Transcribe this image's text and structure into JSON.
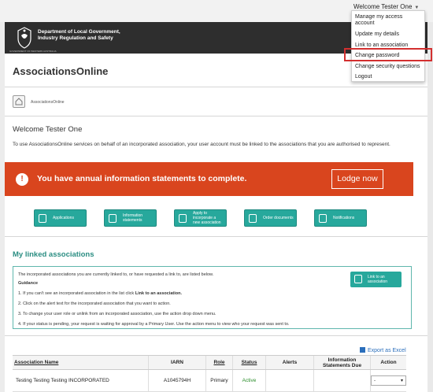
{
  "header": {
    "user_menu_label": "Welcome Tester One",
    "department_line1": "Department of Local Government,",
    "department_line2": "Industry Regulation and Safety",
    "crest_text": "GOVERNMENT OF WESTERN AUSTRALIA"
  },
  "user_menu": {
    "items": [
      {
        "label": "Manage my access account"
      },
      {
        "label": "Update my details"
      },
      {
        "label": "Link to an association"
      },
      {
        "label": "Change password",
        "highlighted": true
      },
      {
        "label": "Change security questions"
      },
      {
        "label": "Logout"
      }
    ],
    "highlight_color": "#d32f2f"
  },
  "app": {
    "title": "AssociationsOnline",
    "breadcrumb": "AssociationsOnline"
  },
  "welcome": {
    "heading": "Welcome Tester One",
    "intro": "To use AssociationsOnline services on behalf of an incorporated association, your user account must be linked to the associations that you are authorised to represent."
  },
  "alert": {
    "icon": "info-icon",
    "message": "You have annual information statements to complete.",
    "button_label": "Lodge now",
    "color": "#d9451e"
  },
  "shortcuts": [
    {
      "label": "Applications",
      "icon": "applications-icon"
    },
    {
      "label": "Information statements",
      "icon": "information-statements-icon"
    },
    {
      "label": "Apply to incorporate a new association",
      "icon": "incorporate-icon"
    },
    {
      "label": "Order documents",
      "icon": "order-documents-icon"
    },
    {
      "label": "Notifications",
      "icon": "notifications-icon"
    }
  ],
  "linked": {
    "title": "My linked associations",
    "intro": "The incorporated associations you are currently linked to, or have requested a link to, are listed below.",
    "guidance_heading": "Guidance",
    "guidance": [
      {
        "text": "1. If you can't see an incorporated association in the list click ",
        "bold": "Link to an association."
      },
      {
        "text": "2. Click on the alert text for the incorporated association that you want to action.",
        "bold": ""
      },
      {
        "text": "3. To change your user role or unlink from an incorporated association, use the action drop down menu.",
        "bold": ""
      },
      {
        "text": "4. If your status is pending, your request is waiting for approval by a Primary User. Use the action menu to view who your request was sent to.",
        "bold": ""
      }
    ],
    "link_button_label": "Link to an association",
    "accent_color": "#27a89c"
  },
  "table": {
    "export_label": "Export as Excel",
    "headers": [
      "Association Name",
      "IARN",
      "Role",
      "Status",
      "Alerts",
      "Information Statements Due",
      "Action"
    ],
    "rows": [
      {
        "name": "Testing Testing Testing INCORPORATED",
        "iarn": "A1045794H",
        "role": "Primary",
        "status": "Active",
        "alerts": "",
        "statements_due": "",
        "action": "-"
      }
    ]
  }
}
